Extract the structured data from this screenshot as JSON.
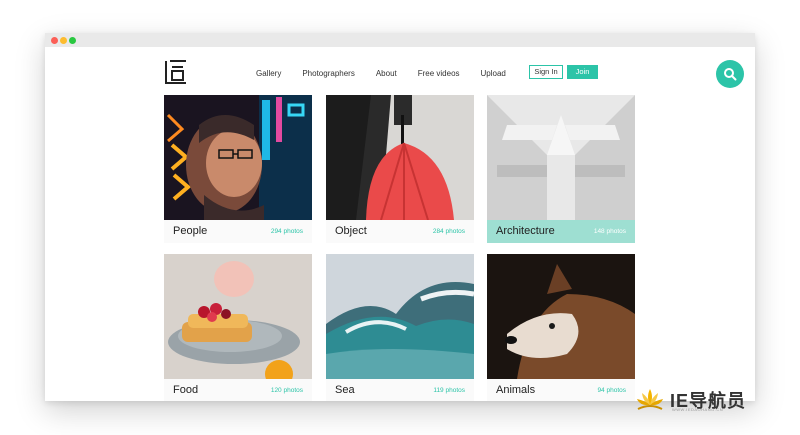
{
  "nav": {
    "items": [
      {
        "label": "Gallery"
      },
      {
        "label": "Photographers"
      },
      {
        "label": "About"
      },
      {
        "label": "Free videos"
      },
      {
        "label": "Upload"
      }
    ],
    "signin_label": "Sign In",
    "join_label": "Join"
  },
  "accent": "#2cc4a8",
  "gallery": [
    {
      "name": "People",
      "count": "294 photos"
    },
    {
      "name": "Object",
      "count": "284 photos"
    },
    {
      "name": "Architecture",
      "count": "148 photos"
    },
    {
      "name": "Food",
      "count": "120 photos"
    },
    {
      "name": "Sea",
      "count": "119 photos"
    },
    {
      "name": "Animals",
      "count": "94 photos"
    }
  ],
  "watermark": {
    "text": "IE导航员",
    "subtext": "WWW.IEDAOHANG.CN"
  }
}
